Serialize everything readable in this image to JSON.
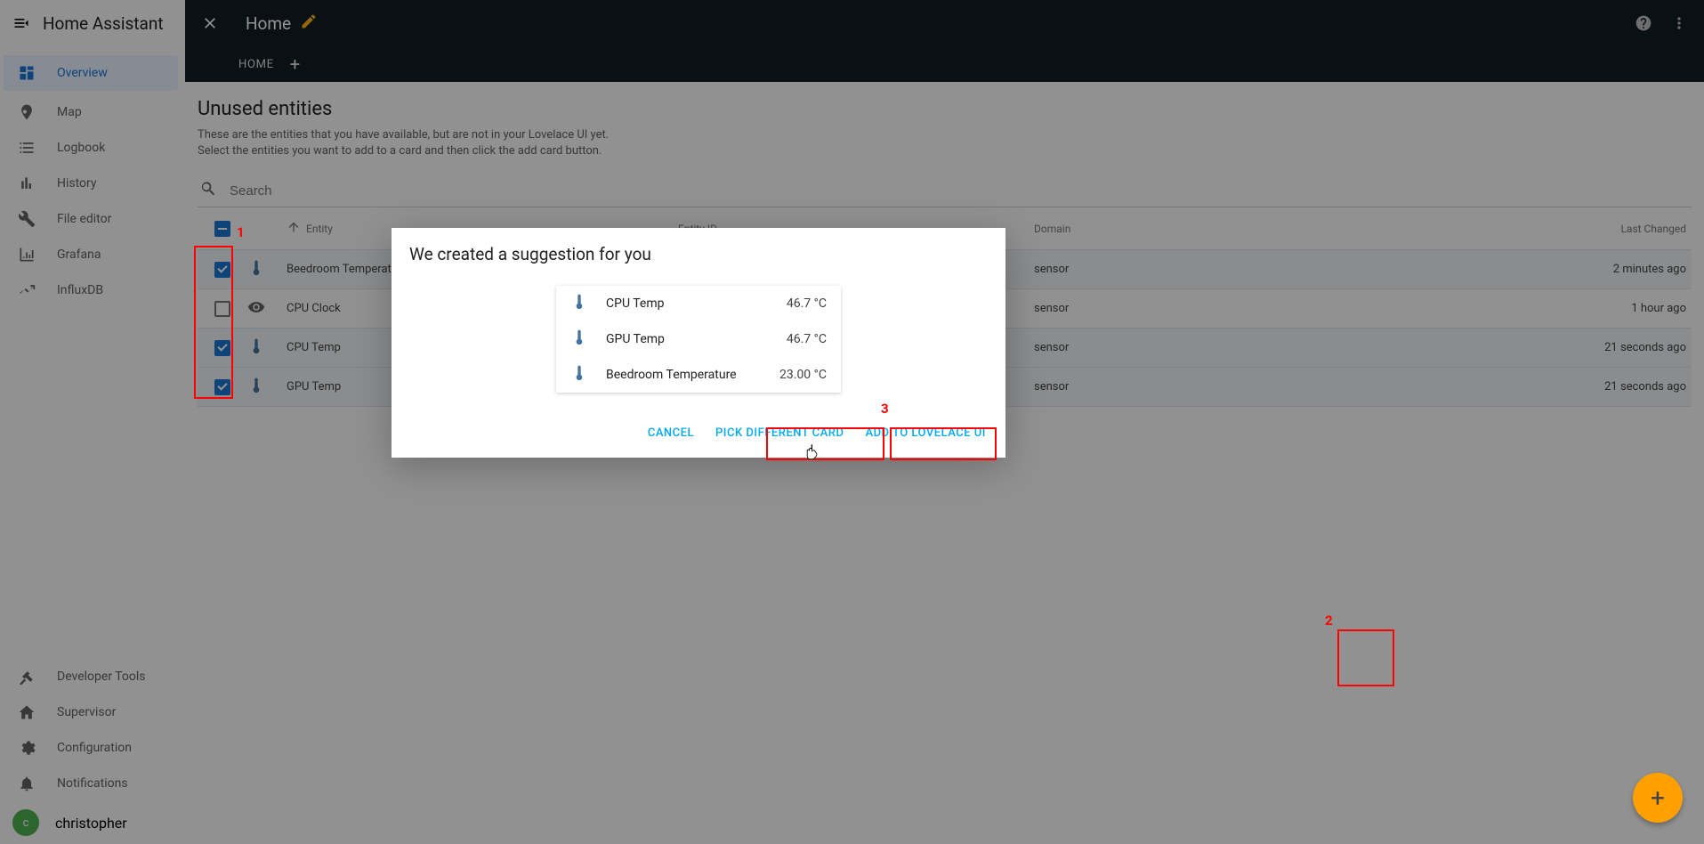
{
  "sidebar": {
    "title": "Home Assistant",
    "items": [
      {
        "label": "Overview",
        "active": true,
        "icon": "dashboard"
      },
      {
        "label": "Map",
        "active": false,
        "icon": "map"
      },
      {
        "label": "Logbook",
        "active": false,
        "icon": "list"
      },
      {
        "label": "History",
        "active": false,
        "icon": "chart"
      },
      {
        "label": "File editor",
        "active": false,
        "icon": "wrench"
      },
      {
        "label": "Grafana",
        "active": false,
        "icon": "graph"
      },
      {
        "label": "InfluxDB",
        "active": false,
        "icon": "trend"
      }
    ],
    "bottom": [
      {
        "label": "Developer Tools",
        "icon": "hammer"
      },
      {
        "label": "Supervisor",
        "icon": "home"
      },
      {
        "label": "Configuration",
        "icon": "gear"
      },
      {
        "label": "Notifications",
        "icon": "bell"
      }
    ],
    "user": {
      "label": "christopher",
      "initial": "c"
    }
  },
  "topbar": {
    "title": "Home",
    "tab": "HOME"
  },
  "page": {
    "title": "Unused entities",
    "help1": "These are the entities that you have available, but are not in your Lovelace UI yet.",
    "help2": "Select the entities you want to add to a card and then click the add card button.",
    "search_placeholder": "Search",
    "col_entity": "Entity",
    "col_eid": "Entity ID",
    "col_domain": "Domain",
    "col_last": "Last Changed"
  },
  "rows": [
    {
      "checked": true,
      "icon": "therm",
      "name": "Beedroom Temperature",
      "domain": "sensor",
      "last": "2 minutes ago"
    },
    {
      "checked": false,
      "icon": "eye",
      "name": "CPU Clock",
      "domain": "sensor",
      "last": "1 hour ago"
    },
    {
      "checked": true,
      "icon": "therm",
      "name": "CPU Temp",
      "domain": "sensor",
      "last": "21 seconds ago"
    },
    {
      "checked": true,
      "icon": "therm",
      "name": "GPU Temp",
      "domain": "sensor",
      "last": "21 seconds ago"
    }
  ],
  "dialog": {
    "title": "We created a suggestion for you",
    "rows": [
      {
        "name": "CPU Temp",
        "value": "46.7 °C"
      },
      {
        "name": "GPU Temp",
        "value": "46.7 °C"
      },
      {
        "name": "Beedroom Temperature",
        "value": "23.00 °C"
      }
    ],
    "cancel": "Cancel",
    "pick": "Pick different card",
    "add": "Add to Lovelace UI"
  },
  "annotations": {
    "1": "1",
    "2": "2",
    "3": "3"
  }
}
